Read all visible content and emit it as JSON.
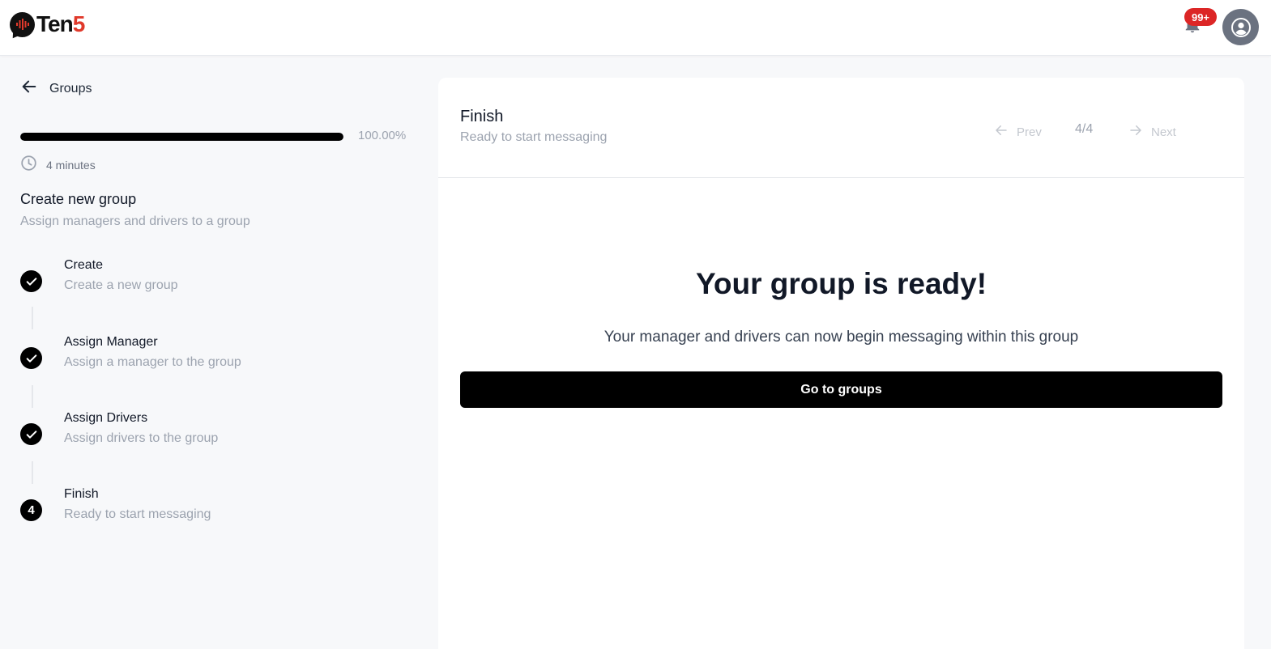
{
  "header": {
    "logo_text_main": "Ten",
    "logo_text_accent": "5",
    "notification_count": "99+",
    "bell_icon": "bell-icon",
    "avatar_icon": "user-avatar-icon"
  },
  "sidebar": {
    "back_label": "Groups",
    "progress": {
      "value": 1.0,
      "label": "100.00%"
    },
    "duration": "4 minutes",
    "title": "Create new group",
    "subtitle": "Assign managers and drivers to a group",
    "steps": [
      {
        "title": "Create",
        "description": "Create a new group",
        "status": "complete"
      },
      {
        "title": "Assign Manager",
        "description": "Assign a manager to the group",
        "status": "complete"
      },
      {
        "title": "Assign Drivers",
        "description": "Assign drivers to the group",
        "status": "complete"
      },
      {
        "title": "Finish",
        "description": "Ready to start messaging",
        "status": "current",
        "number": "4"
      }
    ]
  },
  "main": {
    "title": "Finish",
    "subtitle": "Ready to start messaging",
    "pager": {
      "prev_label": "Prev",
      "count": "4/4",
      "next_label": "Next"
    },
    "heading": "Your group is ready!",
    "message": "Your manager and drivers can now begin messaging within this group",
    "cta_label": "Go to groups"
  },
  "colors": {
    "accent": "#000000",
    "brand_red": "#e0392b",
    "badge": "#dc2626",
    "muted": "#9ca3af"
  }
}
